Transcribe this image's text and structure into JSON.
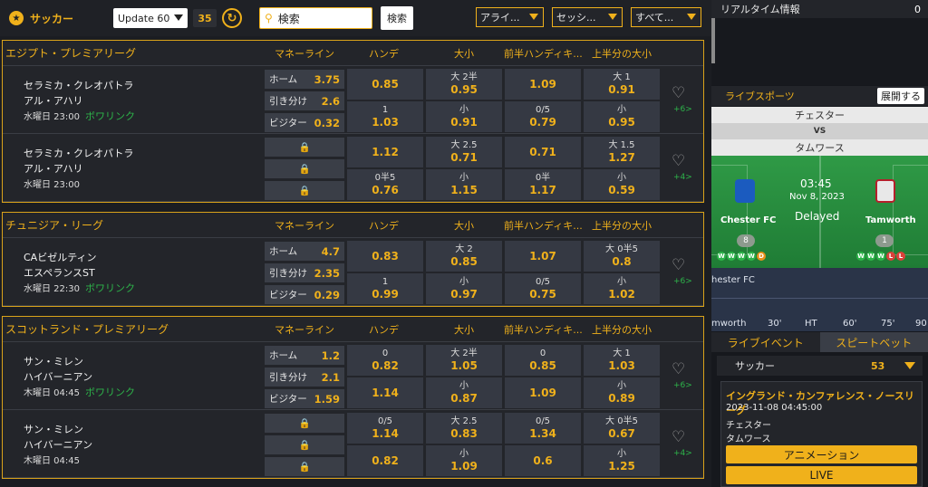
{
  "topbar": {
    "sport": "サッカー",
    "update_label": "Update 60",
    "count": "35",
    "search_placeholder": "検索",
    "search_button": "検索",
    "dropdowns": [
      "アライ...",
      "セッシ...",
      "すべて..."
    ]
  },
  "columns": [
    "マネーライン",
    "ハンデ",
    "大小",
    "前半ハンディキ...",
    "上半分の大小"
  ],
  "leagues": [
    {
      "name": "エジプト・プレミアリーグ",
      "matches": [
        {
          "home": "セラミカ・クレオパトラ",
          "away": "アル・アハリ",
          "time": "水曜日 23:00",
          "live": "ボワリンク",
          "more": "+6>",
          "ml": [
            [
              "ホーム",
              "3.75"
            ],
            [
              "引き分け",
              "2.6"
            ],
            [
              "ビジター",
              "0.32"
            ]
          ],
          "cells": [
            [
              [
                "",
                "0.85"
              ],
              [
                "1",
                "1.03"
              ]
            ],
            [
              [
                "大 2半",
                "0.95"
              ],
              [
                "小",
                "0.91"
              ]
            ],
            [
              [
                "",
                "1.09"
              ],
              [
                "0/5",
                "0.79"
              ]
            ],
            [
              [
                "大 1",
                "0.91"
              ],
              [
                "小",
                "0.95"
              ]
            ]
          ]
        },
        {
          "home": "セラミカ・クレオパトラ",
          "away": "アル・アハリ",
          "time": "水曜日 23:00",
          "live": "",
          "more": "+4>",
          "ml": [],
          "cells": [
            [
              [
                "",
                "1.12"
              ],
              [
                "0半5",
                "0.76"
              ]
            ],
            [
              [
                "大 2.5",
                "0.71"
              ],
              [
                "小",
                "1.15"
              ]
            ],
            [
              [
                "",
                "0.71"
              ],
              [
                "0半",
                "1.17"
              ]
            ],
            [
              [
                "大 1.5",
                "1.27"
              ],
              [
                "小",
                "0.59"
              ]
            ]
          ]
        }
      ]
    },
    {
      "name": "チュニジア・リーグ",
      "matches": [
        {
          "home": "CAビゼルティン",
          "away": "エスペランスST",
          "time": "水曜日 22:30",
          "live": "ボワリンク",
          "more": "+6>",
          "ml": [
            [
              "ホーム",
              "4.7"
            ],
            [
              "引き分け",
              "2.35"
            ],
            [
              "ビジター",
              "0.29"
            ]
          ],
          "cells": [
            [
              [
                "",
                "0.83"
              ],
              [
                "1",
                "0.99"
              ]
            ],
            [
              [
                "大 2",
                "0.85"
              ],
              [
                "小",
                "0.97"
              ]
            ],
            [
              [
                "",
                "1.07"
              ],
              [
                "0/5",
                "0.75"
              ]
            ],
            [
              [
                "大 0半5",
                "0.8"
              ],
              [
                "小",
                "1.02"
              ]
            ]
          ]
        }
      ]
    },
    {
      "name": "スコットランド・プレミアリーグ",
      "matches": [
        {
          "home": "サン・ミレン",
          "away": "ハイバーニアン",
          "time": "木曜日 04:45",
          "live": "ボワリンク",
          "more": "+6>",
          "ml": [
            [
              "ホーム",
              "1.2"
            ],
            [
              "引き分け",
              "2.1"
            ],
            [
              "ビジター",
              "1.59"
            ]
          ],
          "cells": [
            [
              [
                "0",
                "0.82"
              ],
              [
                "",
                "1.14"
              ]
            ],
            [
              [
                "大 2半",
                "1.05"
              ],
              [
                "小",
                "0.87"
              ]
            ],
            [
              [
                "0",
                "0.85"
              ],
              [
                "",
                "1.09"
              ]
            ],
            [
              [
                "大 1",
                "1.03"
              ],
              [
                "小",
                "0.89"
              ]
            ]
          ]
        },
        {
          "home": "サン・ミレン",
          "away": "ハイバーニアン",
          "time": "木曜日 04:45",
          "live": "",
          "more": "+4>",
          "ml": [],
          "cells": [
            [
              [
                "0/5",
                "1.14"
              ],
              [
                "",
                "0.82"
              ]
            ],
            [
              [
                "大 2.5",
                "0.83"
              ],
              [
                "小",
                "1.09"
              ]
            ],
            [
              [
                "0/5",
                "1.34"
              ],
              [
                "",
                "0.6"
              ]
            ],
            [
              [
                "大 0半5",
                "0.67"
              ],
              [
                "小",
                "1.25"
              ]
            ]
          ]
        }
      ]
    }
  ],
  "right": {
    "realtime_title": "リアルタイム情報",
    "realtime_count": "0",
    "live_sports_title": "ライブスポーツ",
    "expand_button": "展開する",
    "home_team": "チェスター",
    "vs": "VS",
    "away_team": "タムワース",
    "clock": "03:45",
    "date": "Nov 8, 2023",
    "status": "Delayed",
    "home_en": "Chester FC",
    "away_en": "Tamworth",
    "home_pos": "8",
    "away_pos": "1",
    "home_form": [
      "W",
      "W",
      "W",
      "W",
      "D"
    ],
    "away_form": [
      "W",
      "W",
      "W",
      "L",
      "L"
    ],
    "timeline_home": "hester FC",
    "timeline_away": "mworth",
    "timeline_ticks": [
      "30'",
      "HT",
      "60'",
      "75'",
      "90"
    ],
    "tabs": [
      "ライブイベント",
      "スピートベット"
    ],
    "sport": "サッカー",
    "sport_count": "53",
    "card_league": "イングランド・カンファレンス・ノースリーグ",
    "card_datetime": "2023-11-08 04:45:00",
    "card_home": "チェスター",
    "card_away": "タムワース",
    "btn_animation": "アニメーション",
    "btn_live": "LIVE",
    "colors": {
      "accent": "#f0b11b",
      "win": "#2db44a",
      "draw": "#e8901a",
      "loss": "#d9413a"
    }
  }
}
